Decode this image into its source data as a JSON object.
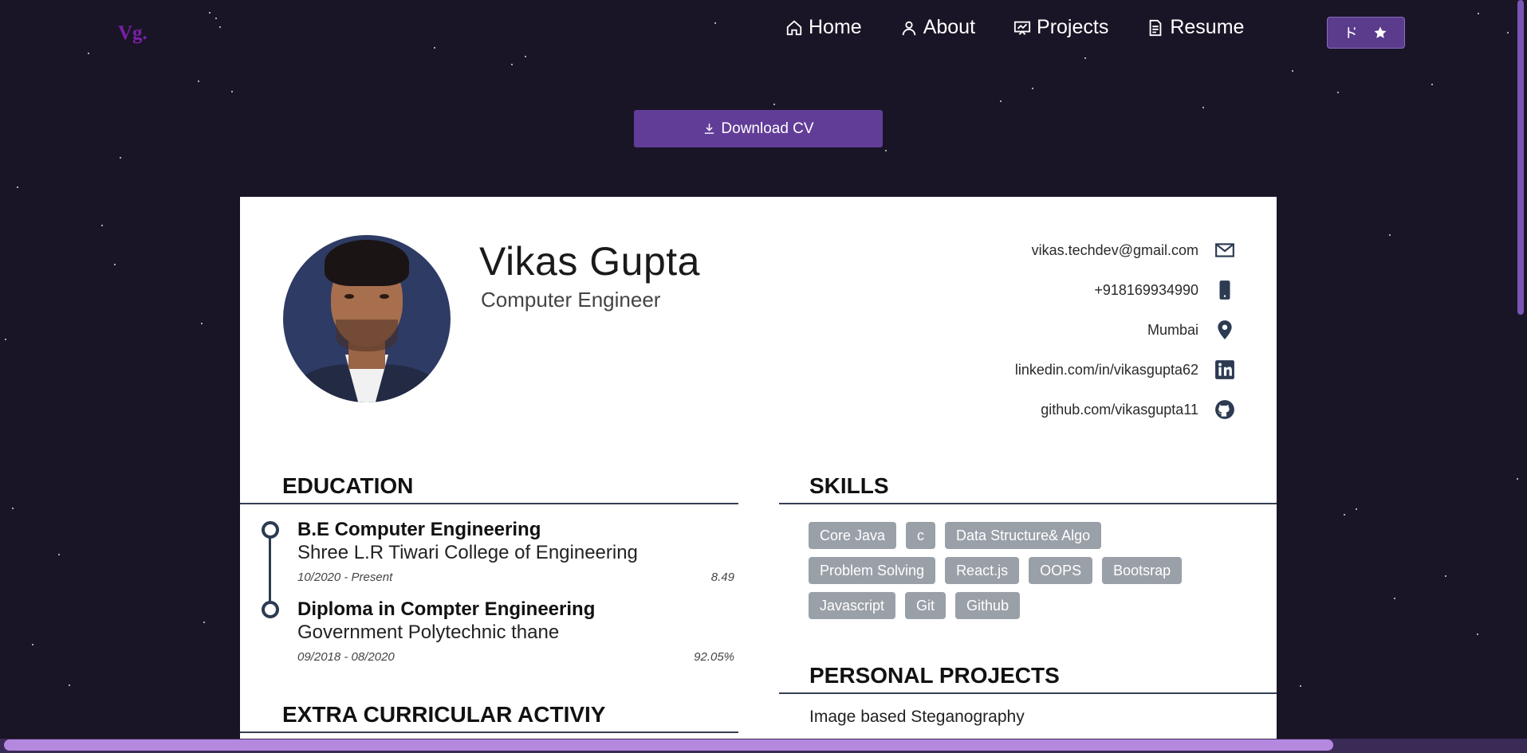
{
  "navbar": {
    "logo": "Vg.",
    "items": [
      {
        "label": "Home",
        "icon": "home-icon"
      },
      {
        "label": "About",
        "icon": "user-icon"
      },
      {
        "label": "Projects",
        "icon": "projects-icon"
      },
      {
        "label": "Resume",
        "icon": "document-icon"
      }
    ]
  },
  "download": {
    "label": "Download CV"
  },
  "resume": {
    "name": "Vikas Gupta",
    "title": "Computer Engineer",
    "contacts": [
      {
        "text": "vikas.techdev@gmail.com",
        "icon": "email-icon"
      },
      {
        "text": "+918169934990",
        "icon": "phone-icon"
      },
      {
        "text": "Mumbai",
        "icon": "location-icon"
      },
      {
        "text": "linkedin.com/in/vikasgupta62",
        "icon": "linkedin-icon"
      },
      {
        "text": "github.com/vikasgupta11",
        "icon": "github-icon"
      }
    ],
    "education": {
      "heading": "EDUCATION",
      "items": [
        {
          "degree": "B.E Computer Engineering",
          "school": "Shree L.R Tiwari College of Engineering",
          "dates": "10/2020 - Present",
          "score": "8.49"
        },
        {
          "degree": "Diploma in Compter Engineering",
          "school": "Government Polytechnic thane",
          "dates": "09/2018 - 08/2020",
          "score": "92.05%"
        }
      ]
    },
    "extra": {
      "heading": "EXTRA CURRICULAR ACTIVIY"
    },
    "skills": {
      "heading": "SKILLS",
      "items": [
        "Core Java",
        "c",
        "Data Structure& Algo",
        "Problem Solving",
        "React.js",
        "OOPS",
        "Bootsrap",
        "Javascript",
        "Git",
        "Github"
      ]
    },
    "projects": {
      "heading": "PERSONAL PROJECTS",
      "items": [
        "Image based Steganography"
      ]
    }
  },
  "colors": {
    "background": "#1a1526",
    "accent": "#623d98",
    "skill_badge": "#9aa0a8"
  }
}
